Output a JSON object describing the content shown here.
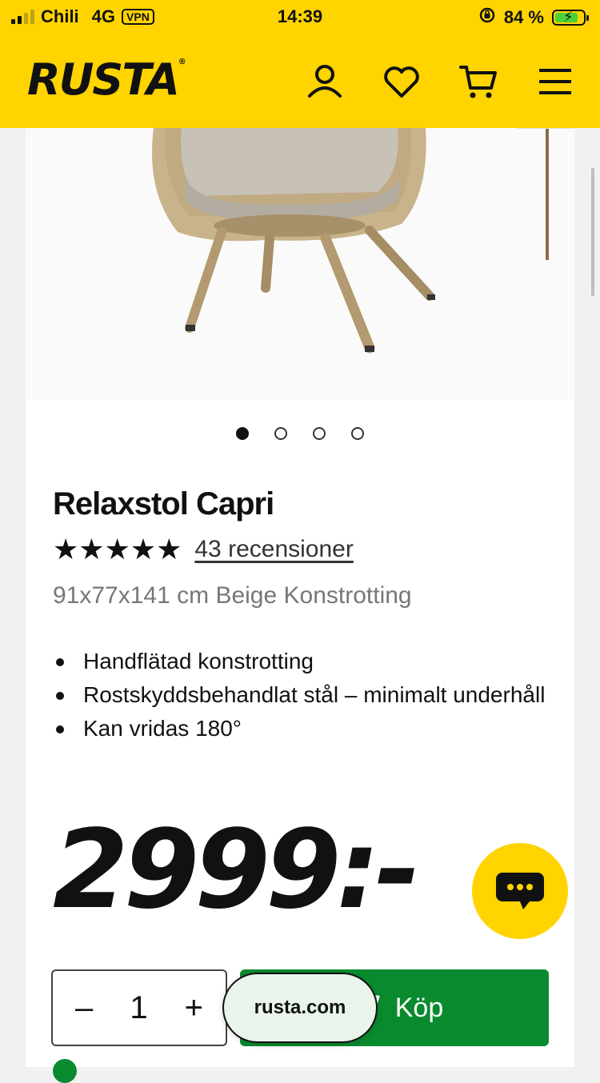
{
  "status_bar": {
    "carrier": "Chili",
    "network": "4G",
    "vpn": "VPN",
    "time": "14:39",
    "battery": "84 %"
  },
  "header": {
    "logo": "RUSTA",
    "logo_mark": "®",
    "icons": [
      "account-icon",
      "heart-icon",
      "cart-icon",
      "menu-icon"
    ]
  },
  "gallery": {
    "slides": 4,
    "active_slide": 1
  },
  "product": {
    "title": "Relaxstol Capri",
    "stars": "★★★★★",
    "rating": 5,
    "reviews": "43 recensioner",
    "subtitle": "91x77x141 cm Beige Konstrotting",
    "features": [
      "Handflätad konstrotting",
      "Rostskyddsbehandlat stål – minimalt underhåll",
      "Kan vridas 180°"
    ],
    "price": "2999:-"
  },
  "purchase": {
    "quantity": "1",
    "minus": "–",
    "plus": "+",
    "buy_label": "Köp"
  },
  "browser": {
    "url": "rusta.com"
  },
  "colors": {
    "brand_yellow": "#ffd400",
    "buy_green": "#0a8a2e"
  }
}
